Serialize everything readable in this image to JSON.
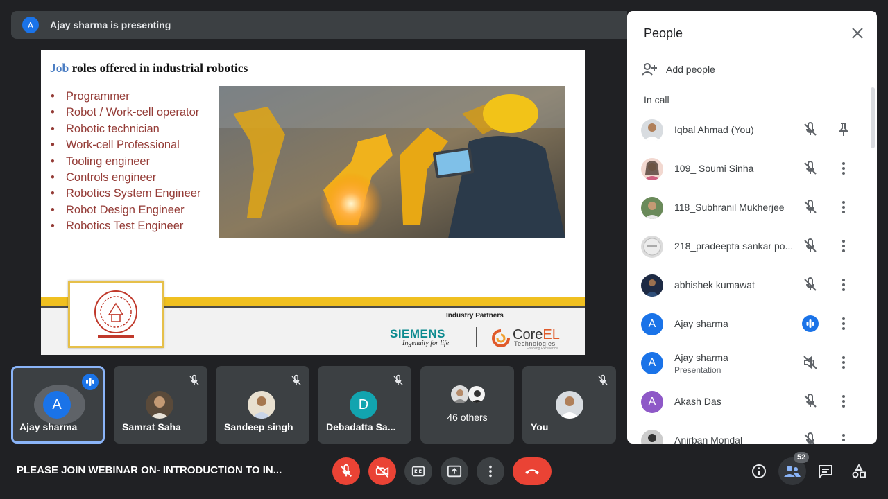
{
  "banner": {
    "avatar_letter": "A",
    "text": "Ajay sharma is presenting"
  },
  "slide": {
    "title_accent": "Job",
    "title_rest": " roles offered in industrial robotics",
    "roles": [
      "Programmer",
      "Robot / Work-cell operator",
      "Robotic technician",
      "Work-cell Professional",
      "Tooling engineer",
      "Controls engineer",
      "Robotics System Engineer",
      "Robot Design Engineer",
      "Robotics Test Engineer"
    ],
    "industry_partners": "Industry Partners",
    "siemens": "SIEMENS",
    "siemens_tagline": "Ingenuity for life",
    "corel_main": "Core",
    "corel_el": "EL",
    "corel_sub": "Technologies",
    "corel_tiny": "Enabling Excellence"
  },
  "tiles": [
    {
      "name": "Ajay sharma",
      "letter": "A",
      "avatar_color": "#1a73e8"
    },
    {
      "name": "Samrat Saha"
    },
    {
      "name": "Sandeep singh"
    },
    {
      "name": "Debadatta Sa...",
      "letter": "D",
      "avatar_color": "#12a4af"
    },
    {
      "name": "46 others"
    },
    {
      "name": "You"
    }
  ],
  "people_panel": {
    "title": "People",
    "add_people": "Add people",
    "section": "In call",
    "participants": [
      {
        "name": "Iqbal Ahmad (You)"
      },
      {
        "name": "109_ Soumi Sinha"
      },
      {
        "name": "118_Subhranil Mukherjee"
      },
      {
        "name": "218_pradeepta sankar po..."
      },
      {
        "name": "abhishek kumawat"
      },
      {
        "name": "Ajay sharma",
        "letter": "A",
        "avatar_color": "#1a73e8"
      },
      {
        "name": "Ajay sharma",
        "sub": "Presentation",
        "letter": "A",
        "avatar_color": "#1a73e8"
      },
      {
        "name": "Akash Das",
        "letter": "A",
        "avatar_color": "#8e58c7"
      },
      {
        "name": "Anirban Mondal"
      }
    ]
  },
  "bottom_bar": {
    "meeting_title": "PLEASE JOIN WEBINAR ON- INTRODUCTION TO IN...",
    "people_count": "52"
  },
  "colors": {
    "accent": "#1a73e8",
    "danger": "#ea4335",
    "surface": "#3c4043",
    "background": "#202124"
  }
}
